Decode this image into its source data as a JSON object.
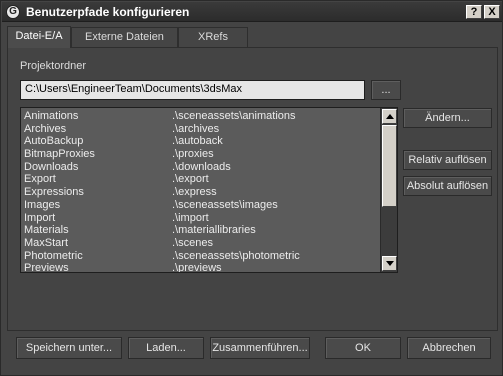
{
  "window": {
    "title": "Benutzerpfade konfigurieren",
    "help_label": "?",
    "close_label": "X",
    "app_icon_glyph": "G"
  },
  "tabs": [
    {
      "label": "Datei-E/A",
      "active": true
    },
    {
      "label": "Externe Dateien",
      "active": false
    },
    {
      "label": "XRefs",
      "active": false
    }
  ],
  "project": {
    "label": "Projektordner",
    "path": "C:\\Users\\EngineerTeam\\Documents\\3dsMax",
    "browse_label": "..."
  },
  "paths": [
    {
      "name": "Animations",
      "path": ".\\sceneassets\\animations"
    },
    {
      "name": "Archives",
      "path": ".\\archives"
    },
    {
      "name": "AutoBackup",
      "path": ".\\autoback"
    },
    {
      "name": "BitmapProxies",
      "path": ".\\proxies"
    },
    {
      "name": "Downloads",
      "path": ".\\downloads"
    },
    {
      "name": "Export",
      "path": ".\\export"
    },
    {
      "name": "Expressions",
      "path": ".\\express"
    },
    {
      "name": "Images",
      "path": ".\\sceneassets\\images"
    },
    {
      "name": "Import",
      "path": ".\\import"
    },
    {
      "name": "Materials",
      "path": ".\\materiallibraries"
    },
    {
      "name": "MaxStart",
      "path": ".\\scenes"
    },
    {
      "name": "Photometric",
      "path": ".\\sceneassets\\photometric"
    },
    {
      "name": "Previews",
      "path": ".\\previews"
    }
  ],
  "side_buttons": {
    "aendern": "Ändern...",
    "relativ": "Relativ auflösen",
    "absolut": "Absolut auflösen"
  },
  "bottom_buttons": {
    "speichern": "Speichern unter...",
    "laden": "Laden...",
    "zusammen": "Zusammenführen...",
    "ok": "OK",
    "abbrechen": "Abbrechen"
  },
  "colors": {
    "background": "#444444",
    "list_background": "#5b5b5b",
    "input_background": "#e6e6e6",
    "titlebar": "#2c2c2c"
  }
}
